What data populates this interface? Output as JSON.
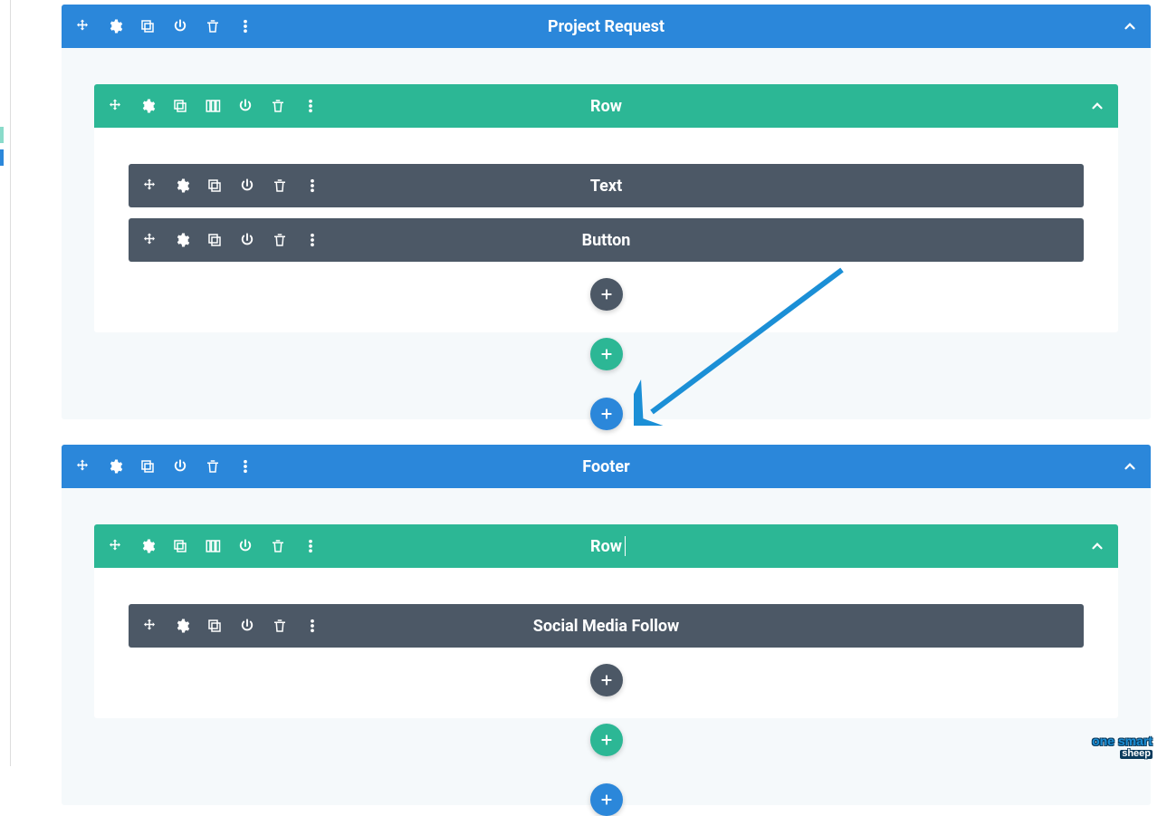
{
  "sections": [
    {
      "title": "Project Request",
      "rows": [
        {
          "title": "Row",
          "modules": [
            {
              "title": "Text"
            },
            {
              "title": "Button"
            }
          ]
        }
      ]
    },
    {
      "title": "Footer",
      "rows": [
        {
          "title": "Row",
          "has_caret": true,
          "modules": [
            {
              "title": "Social Media Follow"
            }
          ]
        }
      ]
    }
  ],
  "logo": {
    "line1": "one smart",
    "line2": "sheep"
  },
  "colors": {
    "section": "#2b87da",
    "row": "#2cb795",
    "module": "#4c5866",
    "canvas_bg": "#f5f9fb"
  }
}
